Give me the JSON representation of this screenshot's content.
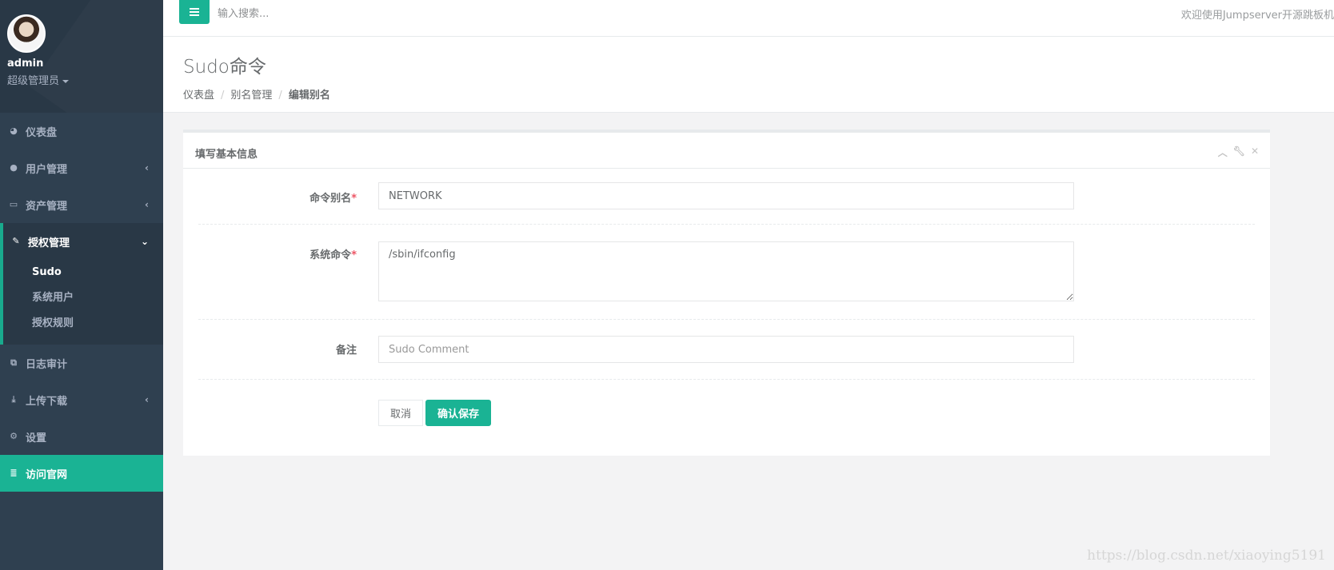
{
  "profile": {
    "name": "admin",
    "role": "超级管理员"
  },
  "nav": {
    "dashboard": "仪表盘",
    "users": "用户管理",
    "assets": "资产管理",
    "perms": "授权管理",
    "perm_sub": [
      "Sudo",
      "系统用户",
      "授权规则"
    ],
    "logs": "日志审计",
    "transfer": "上传下载",
    "settings": "设置",
    "website": "访问官网"
  },
  "topbar": {
    "search_placeholder": "输入搜索...",
    "welcome": "欢迎使用Jumpserver开源跳板机"
  },
  "heading": {
    "title": "Sudo命令",
    "breadcrumb": [
      "仪表盘",
      "别名管理",
      "编辑别名"
    ]
  },
  "panel": {
    "title": "填写基本信息",
    "fields": {
      "alias_label": "命令别名",
      "alias_value": "NETWORK",
      "cmd_label": "系统命令",
      "cmd_value": "/sbin/ifconfig",
      "comment_label": "备注",
      "comment_placeholder": "Sudo Comment"
    },
    "cancel": "取消",
    "save": "确认保存"
  },
  "watermark": "https://blog.csdn.net/xiaoying5191",
  "colors": {
    "sidebar": "#2f4050",
    "accent": "#1ab394"
  }
}
